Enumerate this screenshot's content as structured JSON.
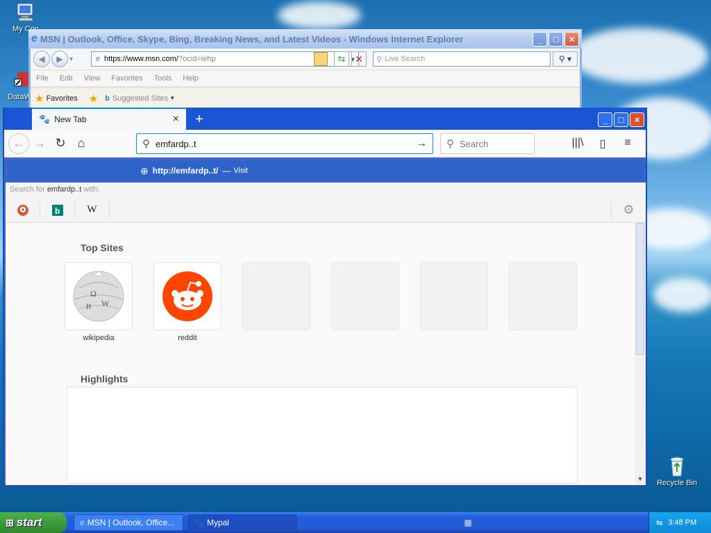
{
  "desktop": {
    "icons": [
      {
        "label": "My Con"
      },
      {
        "label": "DataWa"
      },
      {
        "label": "Recycle Bin"
      }
    ]
  },
  "ie": {
    "title": "MSN | Outlook, Office, Skype, Bing, Breaking News, and Latest Videos - Windows Internet Explorer",
    "address_host": "https://www.msn.com/",
    "address_rest": "?ocid=iehp",
    "search_placeholder": "Live Search",
    "menu": [
      "File",
      "Edit",
      "View",
      "Favorites",
      "Tools",
      "Help"
    ],
    "favorites_label": "Favorites",
    "suggested_label": "Suggested Sites"
  },
  "firefox": {
    "tab_title": "New Tab",
    "url_text": "emfardp..t",
    "search_placeholder": "Search",
    "suggestion_url": "http://emfardp..t/",
    "suggestion_dash": "—",
    "suggestion_action": "Visit",
    "search_with_prefix": "Search for",
    "search_with_query": "emfardp..t",
    "search_with_suffix": "with:",
    "engines": [
      "duckduckgo-icon",
      "bing-icon",
      "wikipedia-icon"
    ],
    "top_sites_title": "Top Sites",
    "top_sites": [
      {
        "label": "wikipedia"
      },
      {
        "label": "reddit"
      }
    ],
    "highlights_title": "Highlights"
  },
  "taskbar": {
    "start_label": "start",
    "items": [
      {
        "label": "MSN | Outlook, Office..."
      },
      {
        "label": "Mypal"
      }
    ],
    "clock": "3:48 PM"
  },
  "colors": {
    "ff_accent": "#0a84ff",
    "suggestion_bg": "#2e63c9",
    "reddit": "#ff4500",
    "bing": "#008373"
  }
}
